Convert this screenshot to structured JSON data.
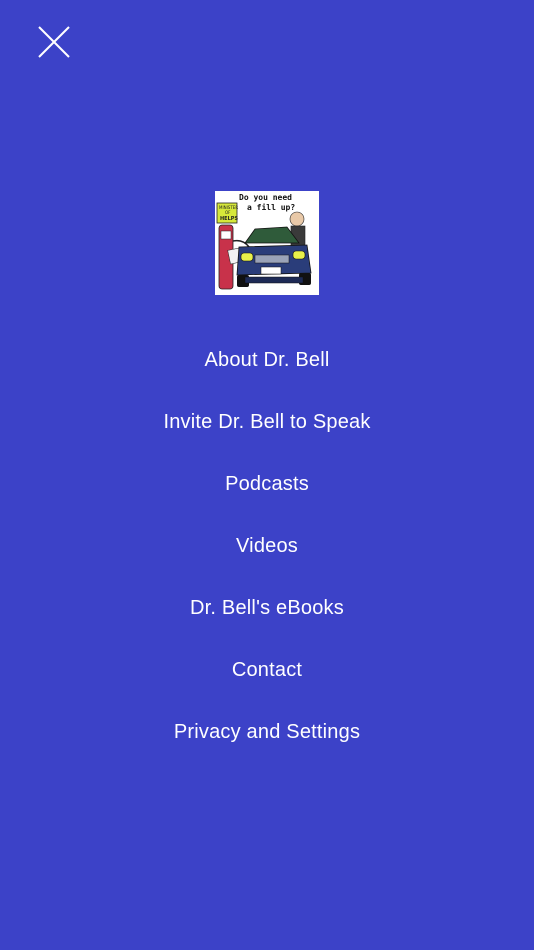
{
  "close_button": {
    "icon": "close-icon"
  },
  "logo": {
    "text_line1": "Do you need",
    "text_line2": "a fill up?",
    "sign_line1": "MINISTER",
    "sign_line2": "OF",
    "sign_line3": "HELPS",
    "background": "#ffffff"
  },
  "menu": {
    "items": [
      {
        "label": "About Dr. Bell"
      },
      {
        "label": "Invite Dr. Bell to Speak"
      },
      {
        "label": "Podcasts"
      },
      {
        "label": "Videos"
      },
      {
        "label": "Dr. Bell's eBooks"
      },
      {
        "label": "Contact"
      },
      {
        "label": "Privacy and Settings"
      }
    ]
  },
  "colors": {
    "background": "#3c42c8",
    "text": "#ffffff"
  }
}
